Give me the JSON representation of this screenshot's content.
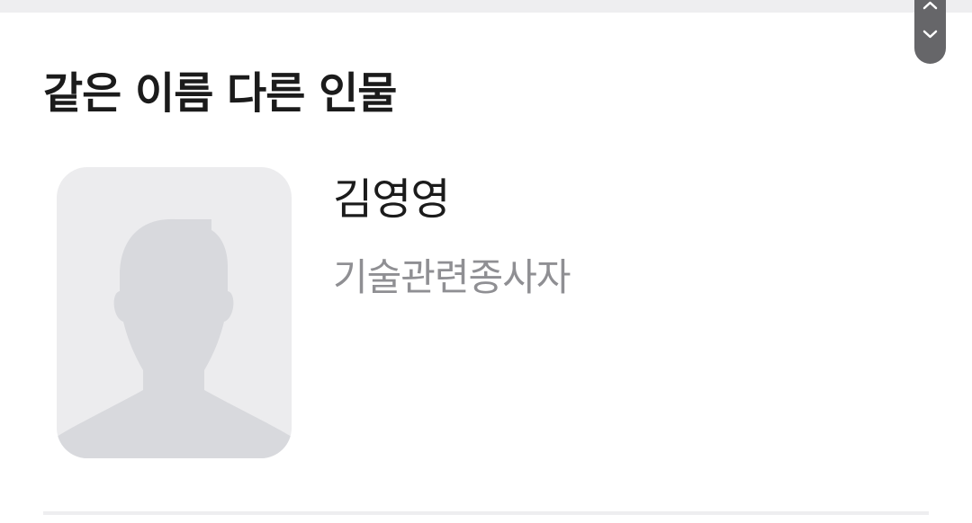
{
  "section": {
    "title": "같은 이름 다른 인물"
  },
  "person": {
    "name": "김영영",
    "occupation": "기술관련종사자",
    "avatar": "default-person-silhouette"
  },
  "scroll_controls": {
    "up_icon": "chevron-up-icon",
    "down_icon": "chevron-down-icon"
  },
  "colors": {
    "title_text": "#1b1b1b",
    "secondary_text": "#8f8f93",
    "avatar_bg": "#ececee",
    "avatar_silhouette": "#d8d9dd",
    "scroll_bg": "#666669",
    "divider": "#eeeef0"
  }
}
